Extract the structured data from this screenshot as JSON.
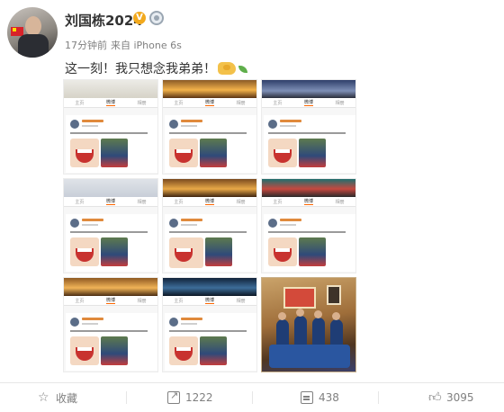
{
  "post": {
    "username": "刘国栋2024",
    "verified_badge": "V",
    "time": "17分钟前",
    "source": "来自 iPhone 6s",
    "text": "这一刻！我只想念我弟弟！",
    "emoji": [
      "handshake-icon",
      "leaf-icon"
    ]
  },
  "images": {
    "count": 9,
    "tab_labels": [
      "主页",
      "微博",
      "相册"
    ]
  },
  "actions": {
    "favorite_label": "收藏",
    "repost_count": "1222",
    "comment_count": "438",
    "like_count": "3095"
  },
  "colors": {
    "verified": "#f2a91d",
    "text": "#333333",
    "meta": "#808080"
  }
}
